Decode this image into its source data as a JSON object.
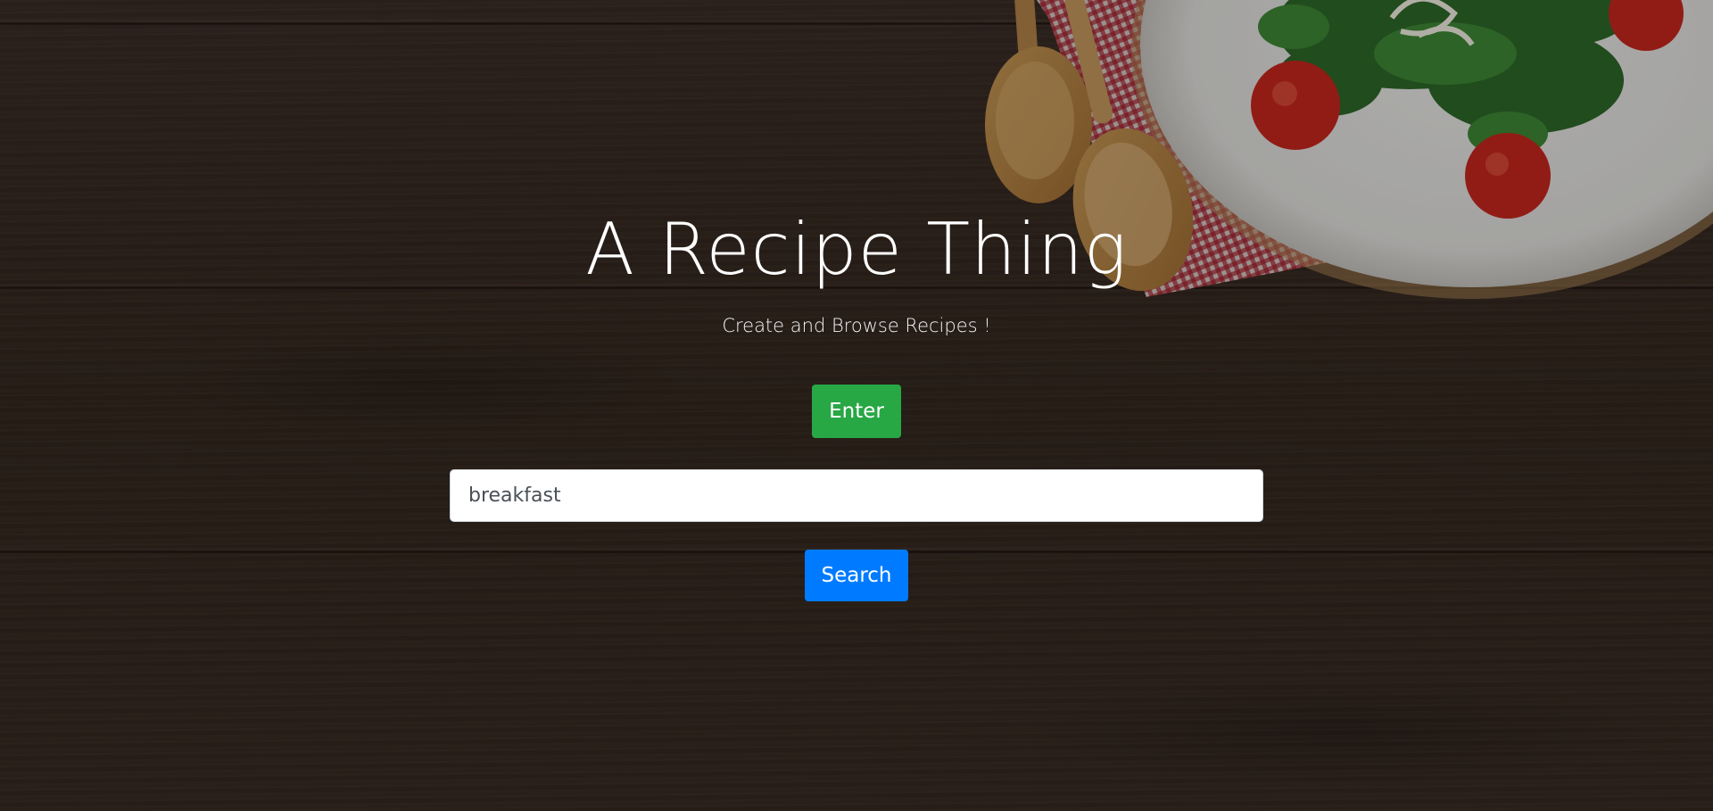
{
  "hero": {
    "title": "A Recipe Thing",
    "subtitle": "Create and Browse Recipes !"
  },
  "actions": {
    "enter_label": "Enter",
    "search_label": "Search"
  },
  "search": {
    "value": "breakfast",
    "placeholder": ""
  },
  "colors": {
    "enter_button": "#28a745",
    "search_button": "#007bff",
    "background": "#3a2c25",
    "text": "#ffffff"
  },
  "background_image": {
    "description_icons": [
      "wooden-spoon-icon",
      "checkered-napkin-icon",
      "salad-plate-icon"
    ]
  }
}
